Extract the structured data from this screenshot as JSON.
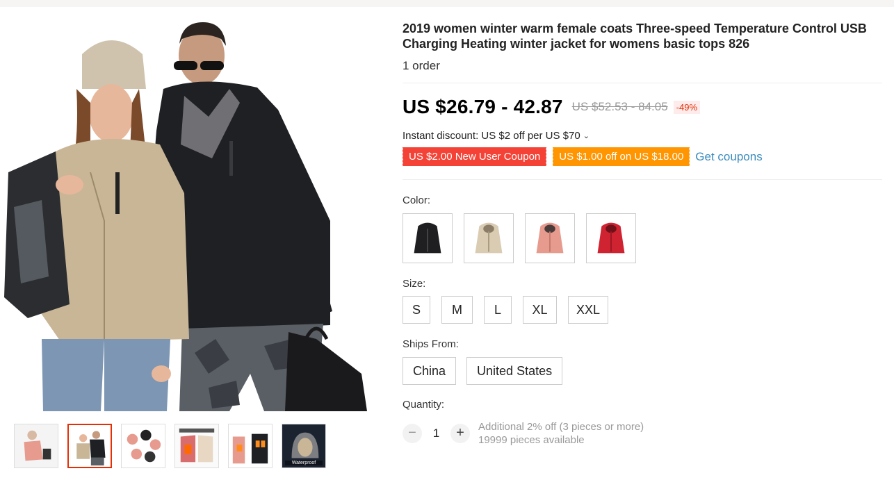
{
  "product": {
    "title": "2019 women winter warm female coats Three-speed Temperature Control USB Charging Heating winter jacket for womens basic tops 826",
    "orders": "1 order",
    "price": "US $26.79 - 42.87",
    "original_price": "US $52.53 - 84.05",
    "discount": "-49%",
    "instant_discount": "Instant discount: US $2 off per US $70",
    "coupons": [
      "US $2.00 New User Coupon",
      "US $1.00 off on US $18.00"
    ],
    "get_coupons": "Get coupons"
  },
  "options": {
    "color_label": "Color:",
    "colors": [
      "#1f1f22",
      "#d9ccb2",
      "#e79b8e",
      "#cf2331"
    ],
    "size_label": "Size:",
    "sizes": [
      "S",
      "M",
      "L",
      "XL",
      "XXL"
    ],
    "ships_label": "Ships From:",
    "ships_from": [
      "China",
      "United States"
    ]
  },
  "quantity": {
    "label": "Quantity:",
    "value": "1",
    "bulk_note": "Additional 2% off (3 pieces or more)",
    "available": "19999 pieces available"
  },
  "gallery": {
    "thumb_6_label": "Waterproof"
  }
}
